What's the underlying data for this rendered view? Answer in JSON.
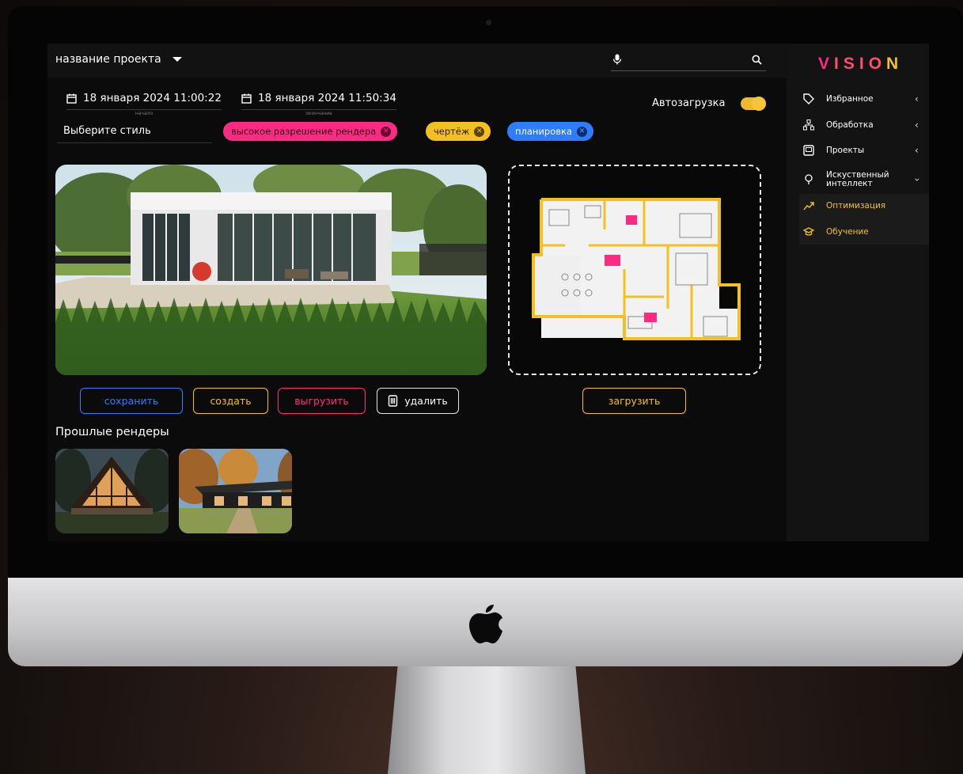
{
  "header": {
    "project_name": "название проекта"
  },
  "dates": {
    "start_value": "18 января 2024 11:00:22",
    "start_caption": "начало",
    "end_value": "18 января 2024 11:50:34",
    "end_caption": "окончание"
  },
  "autoload": {
    "label": "Автозагрузка",
    "enabled": true
  },
  "style_select": {
    "placeholder": "Выберите стиль"
  },
  "tags": [
    {
      "label": "высокое разрешение рендера",
      "color": "#ff2b82"
    },
    {
      "label": "чертёж",
      "color": "#f4c020"
    },
    {
      "label": "планировка",
      "color": "#2f7dff"
    }
  ],
  "actions": {
    "save": "сохранить",
    "create": "создать",
    "export": "выгрузить",
    "delete": "удалить",
    "upload": "загрузить"
  },
  "past_renders": {
    "title": "Прошлые рендеры"
  },
  "sidebar": {
    "logo": {
      "v": "V",
      "middle": "ISIO",
      "n": "N"
    },
    "items": [
      {
        "label": "Избранное",
        "icon": "tag-icon"
      },
      {
        "label": "Обработка",
        "icon": "hierarchy-icon"
      },
      {
        "label": "Проекты",
        "icon": "monitor-icon"
      },
      {
        "label": "Искуственный интеллект",
        "icon": "lightbulb-icon"
      }
    ],
    "subitems": [
      {
        "label": "Оптимизация",
        "icon": "trend-up-icon"
      },
      {
        "label": "Обучение",
        "icon": "graduation-cap-icon"
      }
    ]
  },
  "colors": {
    "accent_pink": "#ff2b82",
    "accent_yellow": "#f4c020",
    "accent_blue": "#2f7dff"
  }
}
